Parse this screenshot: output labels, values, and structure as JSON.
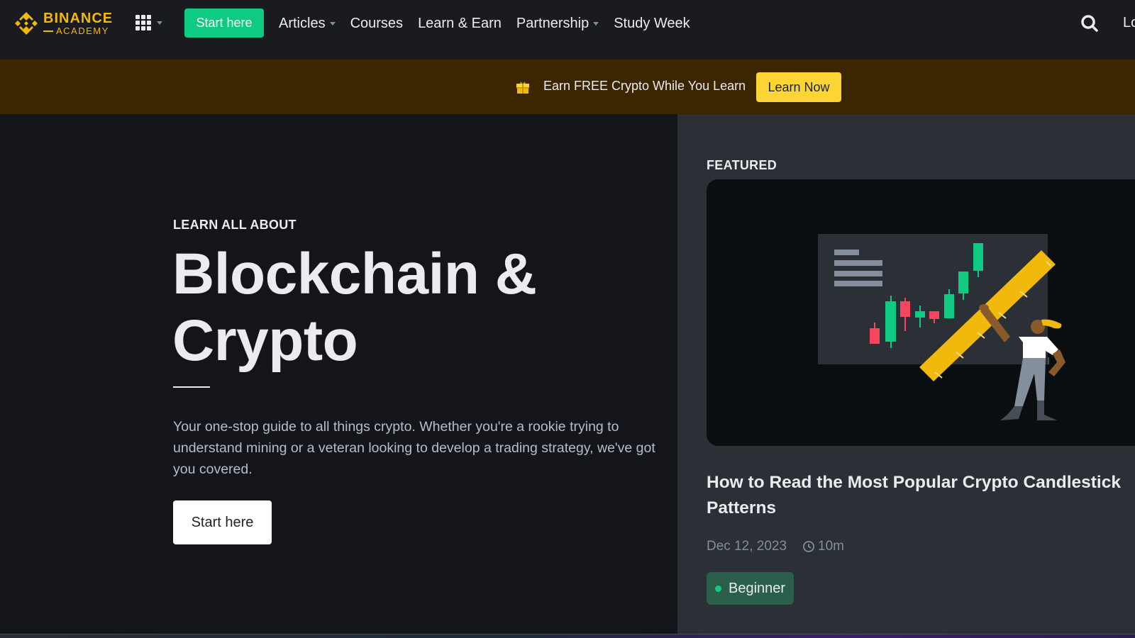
{
  "nav": {
    "brand_line1": "BINANCE",
    "brand_line2": "ACADEMY",
    "apps_icon": "grid-icon",
    "start_here": "Start here",
    "items": [
      {
        "label": "Articles",
        "has_dropdown": true
      },
      {
        "label": "Courses",
        "has_dropdown": false
      },
      {
        "label": "Learn & Earn",
        "has_dropdown": false
      },
      {
        "label": "Partnership",
        "has_dropdown": true
      },
      {
        "label": "Study Week",
        "has_dropdown": false
      }
    ],
    "search_icon": "search-icon",
    "login_partial": "Lo"
  },
  "banner": {
    "icon": "gift-icon",
    "text": "Earn FREE Crypto While You Learn",
    "button": "Learn Now"
  },
  "hero": {
    "eyebrow": "LEARN ALL ABOUT",
    "title_line1": "Blockchain &",
    "title_line2": "Crypto",
    "description": "Your one-stop guide to all things crypto. Whether you're a rookie trying to understand mining or a veteran looking to develop a trading strategy, we've got you covered.",
    "button": "Start here"
  },
  "featured": {
    "label": "FEATURED",
    "illustration": "candlestick-chart-illustration",
    "article": {
      "title": "How to Read the Most Popular Crypto Candlestick Patterns",
      "date": "Dec 12, 2023",
      "read_time": "10m",
      "level": "Beginner"
    }
  },
  "colors": {
    "brand_yellow": "#f0b90b",
    "accent_green": "#0ecb81",
    "button_yellow": "#fcd535",
    "banner_bg": "#3c2601",
    "candle_up": "#0ecb81",
    "candle_down": "#f6465d"
  }
}
